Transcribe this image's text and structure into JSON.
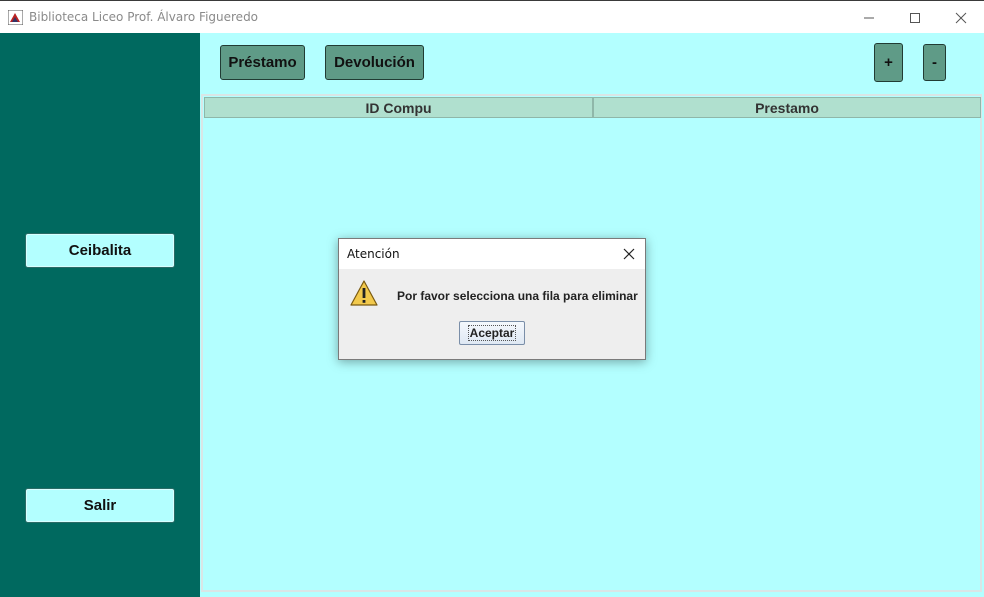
{
  "window": {
    "title": "Biblioteca Liceo Prof. Álvaro Figueredo",
    "controls": {
      "minimize": "—",
      "maximize": "☐",
      "close": "✕"
    }
  },
  "sidebar": {
    "buttons": [
      {
        "label": "Ceibalita"
      },
      {
        "label": "Salir"
      }
    ]
  },
  "toolbar": {
    "prestamo_label": "Préstamo",
    "devolucion_label": "Devolución",
    "add_label": "+",
    "remove_label": "-"
  },
  "table": {
    "columns": [
      "ID Compu",
      "Prestamo"
    ],
    "rows": []
  },
  "dialog": {
    "title": "Atención",
    "message": "Por favor selecciona una fila para eliminar",
    "ok_label": "Aceptar",
    "icon": "warning-icon"
  },
  "colors": {
    "sidebar_bg": "#00695f",
    "content_bg": "#b3ffff",
    "toolbar_button_bg": "#5f9b87",
    "table_header_bg": "#b0e0cf"
  }
}
